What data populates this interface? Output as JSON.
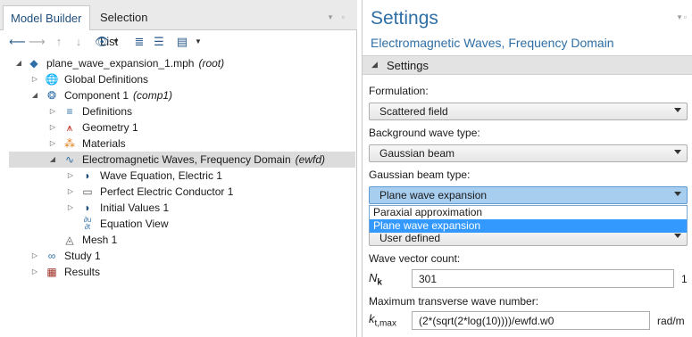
{
  "left_panel": {
    "tabs": [
      {
        "label": "Model Builder"
      },
      {
        "label": "Selection List"
      }
    ],
    "toolbar": [
      "back-icon",
      "forward-icon",
      "up-icon",
      "down-icon",
      "eye-icon",
      "expand-all-icon",
      "collapse-all-icon",
      "show-more-icon"
    ],
    "tree": [
      {
        "label": "plane_wave_expansion_1.mph",
        "tag": "(root)",
        "icon": "model-icon"
      },
      {
        "label": "Global Definitions",
        "tag": "",
        "icon": "globe-icon"
      },
      {
        "label": "Component 1",
        "tag": "(comp1)",
        "icon": "component-icon"
      },
      {
        "label": "Definitions",
        "tag": "",
        "icon": "definitions-icon"
      },
      {
        "label": "Geometry 1",
        "tag": "",
        "icon": "geometry-icon"
      },
      {
        "label": "Materials",
        "tag": "",
        "icon": "materials-icon"
      },
      {
        "label": "Electromagnetic Waves, Frequency Domain",
        "tag": "(ewfd)",
        "icon": "wave-physics-icon"
      },
      {
        "label": "Wave Equation, Electric 1",
        "tag": "",
        "icon": "domain-node-icon"
      },
      {
        "label": "Perfect Electric Conductor 1",
        "tag": "",
        "icon": "boundary-node-icon"
      },
      {
        "label": "Initial Values 1",
        "tag": "",
        "icon": "domain-node-icon"
      },
      {
        "label": "Equation View",
        "tag": "",
        "icon": "equation-view-icon"
      },
      {
        "label": "Mesh 1",
        "tag": "",
        "icon": "mesh-icon"
      },
      {
        "label": "Study 1",
        "tag": "",
        "icon": "study-icon"
      },
      {
        "label": "Results",
        "tag": "",
        "icon": "results-icon"
      }
    ]
  },
  "settings": {
    "title": "Settings",
    "subtitle": "Electromagnetic Waves, Frequency Domain",
    "section": "Settings",
    "formulation_label": "Formulation:",
    "formulation_value": "Scattered field",
    "bg_wave_label": "Background wave type:",
    "bg_wave_value": "Gaussian beam",
    "beam_type_label": "Gaussian beam type:",
    "beam_type_value": "Plane wave expansion",
    "dropdown_options": [
      "Paraxial approximation",
      "Plane wave expansion"
    ],
    "hidden_combo_value": "User defined",
    "wave_count_label": "Wave vector count:",
    "nk_symbol": "N",
    "nk_sub": "k",
    "nk_value": "301",
    "nk_unit": "1",
    "max_wave_label": "Maximum transverse wave number:",
    "kt_symbol": "k",
    "kt_sub": "t,max",
    "kt_value": "(2*(sqrt(2*log(10))))/ewfd.w0",
    "kt_unit": "rad/m"
  }
}
